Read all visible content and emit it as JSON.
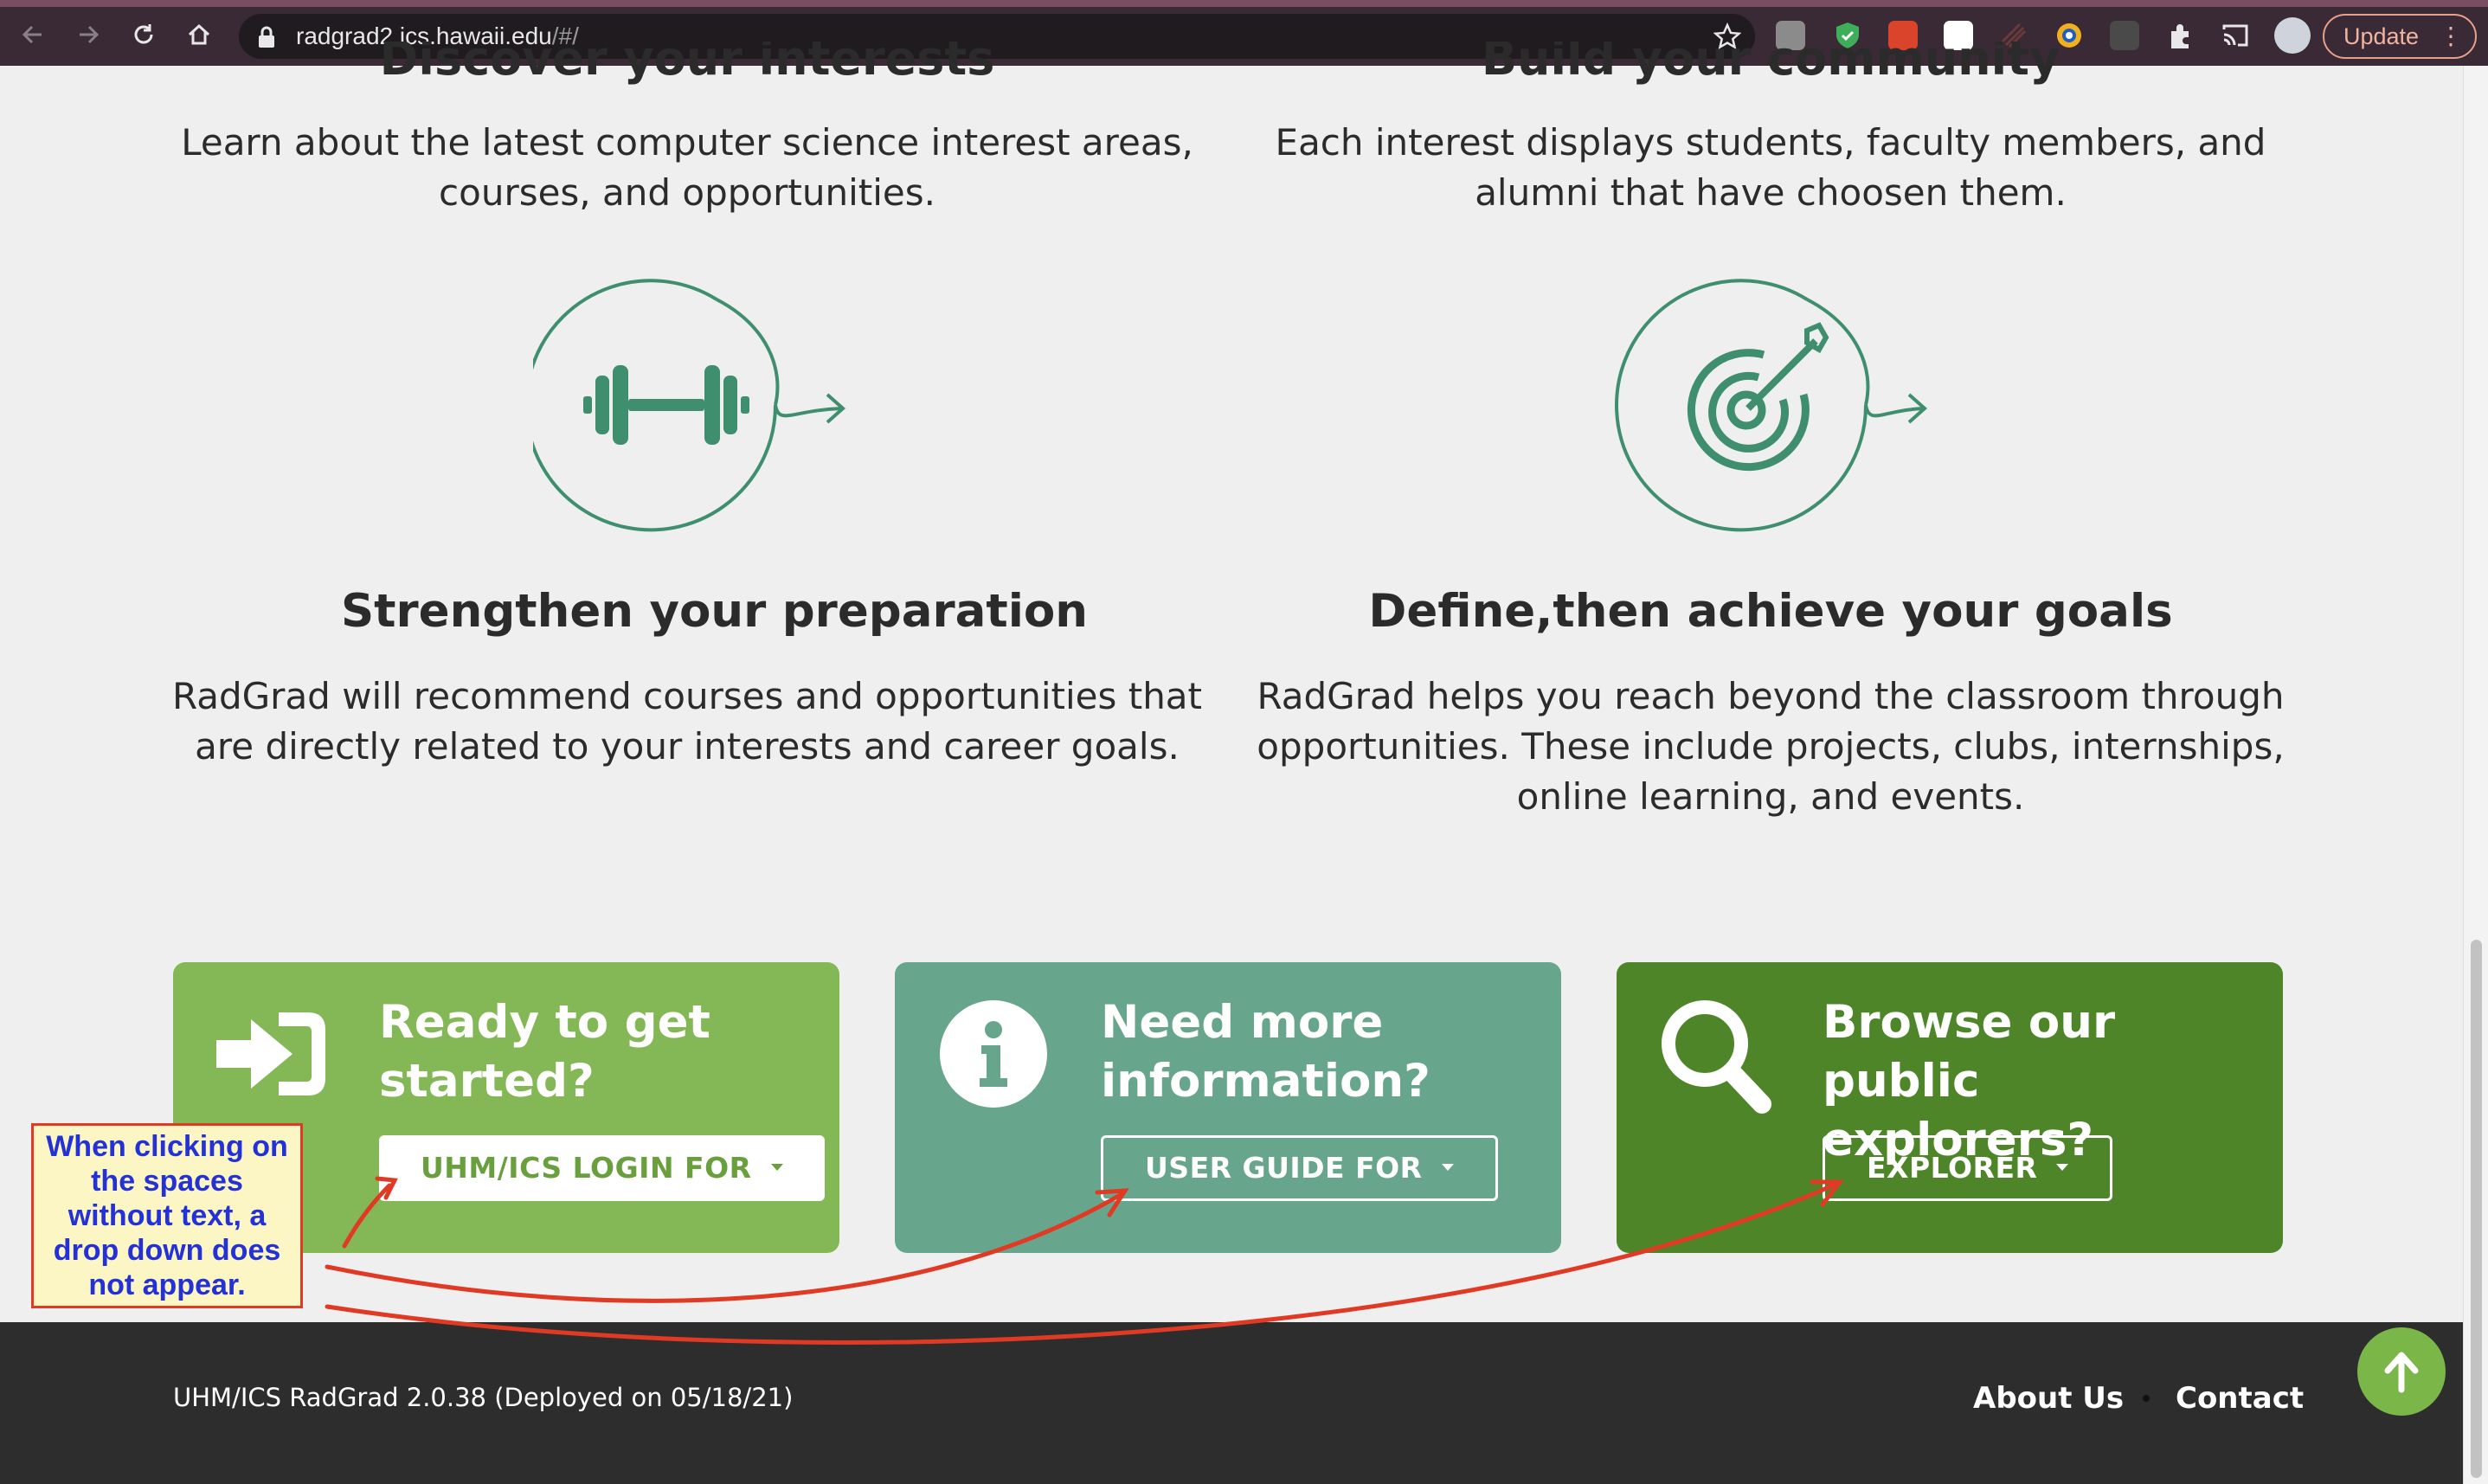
{
  "browser": {
    "url_host": "radgrad2.ics.hawaii.edu",
    "url_path": "/#/",
    "update_label": "Update",
    "menu_glyph": "⋮",
    "toolbar_icons": [
      "back-icon",
      "forward-icon",
      "reload-icon",
      "home-icon",
      "lock-icon",
      "bookmark-star-icon",
      "extensions-icon",
      "cast-icon",
      "profile-avatar"
    ]
  },
  "page": {
    "partial_headings": {
      "left": "Discover your interests",
      "right": "Build your community"
    },
    "top_paragraphs": {
      "left": [
        "Learn about the latest computer science interest areas,",
        "courses, and opportunities."
      ],
      "right": [
        "Each interest displays students, faculty members, and",
        "alumni that have choosen them."
      ]
    },
    "features": [
      {
        "icon": "dumbbell-icon",
        "title": "Strengthen your preparation",
        "lines": [
          "RadGrad will recommend courses and opportunities that",
          "are directly related to your interests and career goals."
        ]
      },
      {
        "icon": "target-icon",
        "title": "Define,then achieve your goals",
        "lines": [
          "RadGrad helps you reach beyond the classroom through",
          "opportunities. These include projects, clubs, internships,",
          "online learning, and events."
        ]
      }
    ],
    "cards": [
      {
        "icon": "sign-in-icon",
        "title": [
          "Ready to get",
          "started?"
        ],
        "button": "UHM/ICS LOGIN FOR",
        "color": "#84b856"
      },
      {
        "icon": "info-icon",
        "title": [
          "Need more",
          "information?"
        ],
        "button": "USER GUIDE FOR",
        "color": "#67a68c"
      },
      {
        "icon": "search-icon",
        "title": [
          "Browse our public",
          "explorers?"
        ],
        "button": "EXPLORER",
        "color": "#4e8529"
      }
    ]
  },
  "footer": {
    "version": "UHM/ICS RadGrad 2.0.38 (Deployed on 05/18/21)",
    "about": "About Us",
    "contact": "Contact"
  },
  "annotation": {
    "note": "When clicking on the spaces without text, a drop down does not appear.",
    "note_lines": [
      "When clicking on",
      "the spaces",
      "without text, a",
      "drop down does",
      "not appear."
    ]
  },
  "colors": {
    "accent_green": "#7ab648",
    "teal": "#3f8f6f",
    "annotation_red": "#e03a25",
    "annotation_text": "#2331d6"
  }
}
